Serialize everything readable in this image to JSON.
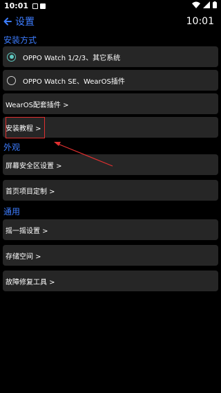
{
  "status_bar": {
    "time": "10:01"
  },
  "header": {
    "title": "设置",
    "clock": "10:01"
  },
  "sections": {
    "install": {
      "title": "安装方式",
      "options": [
        {
          "label": "OPPO Watch 1/2/3、其它系统",
          "checked": true
        },
        {
          "label": "OPPO Watch SE、WearOS插件",
          "checked": false
        }
      ],
      "items": [
        "WearOS配套插件 >",
        "安装教程 >"
      ]
    },
    "appearance": {
      "title": "外观",
      "items": [
        "屏幕安全区设置 >",
        "首页项目定制 >"
      ]
    },
    "general": {
      "title": "通用",
      "items": [
        "摇一摇设置 >",
        "存储空间 >",
        "故障修复工具 >"
      ]
    }
  },
  "colors": {
    "accent": "#3d7dff",
    "card": "#262626",
    "radio": "#5fc8c0",
    "annotation": "#e03030"
  }
}
